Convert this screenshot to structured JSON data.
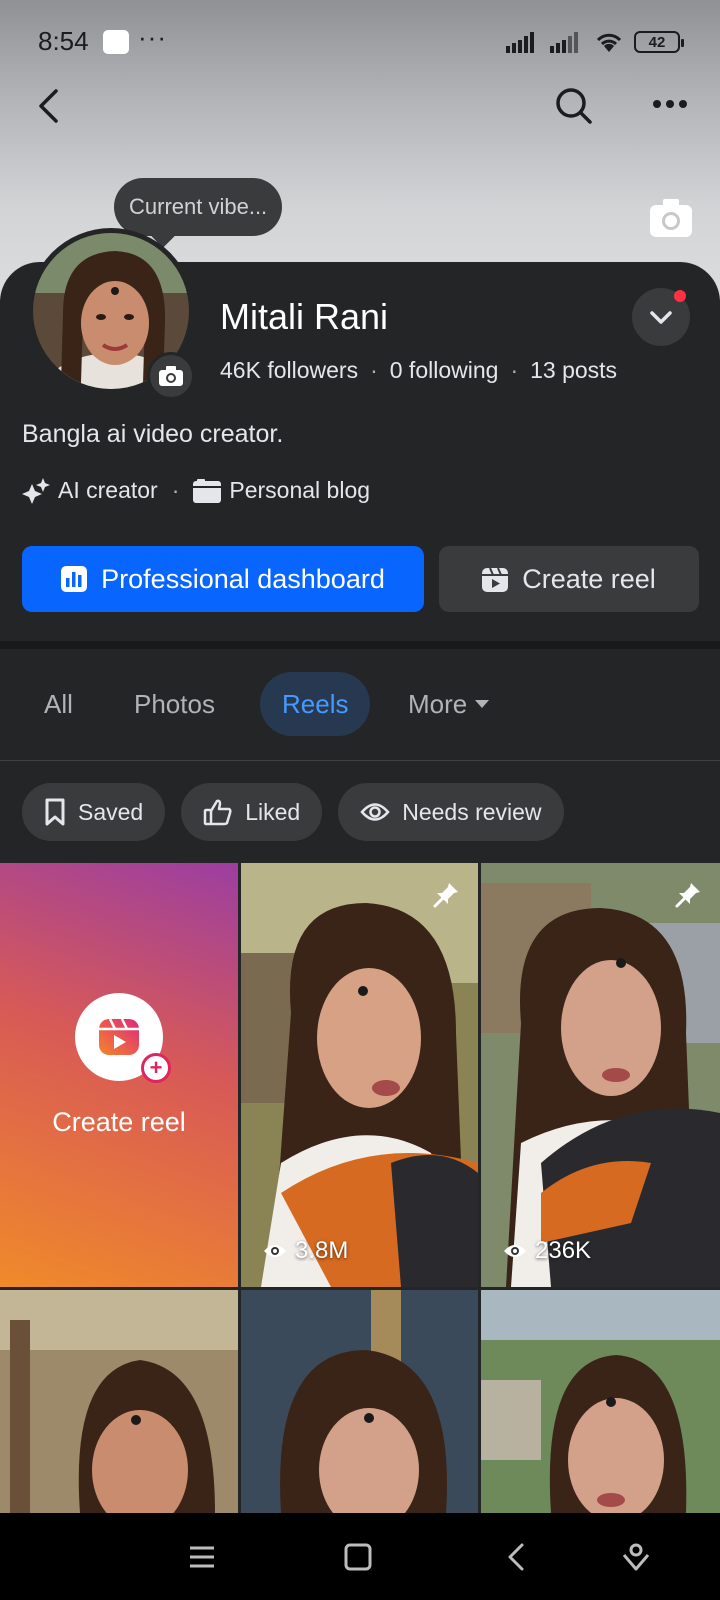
{
  "status_bar": {
    "time": "8:54",
    "more_dots": "···",
    "battery": "42"
  },
  "cover": {
    "vibe_prompt": "Current vibe..."
  },
  "profile": {
    "name": "Mitali Rani",
    "followers": "46K followers",
    "following": "0 following",
    "posts": "13 posts",
    "stats_separator": "·",
    "bio": "Bangla ai video creator.",
    "category_1": "AI creator",
    "category_2": "Personal blog"
  },
  "actions": {
    "dashboard_label": "Professional dashboard",
    "create_reel_label": "Create reel"
  },
  "tabs": {
    "all": "All",
    "photos": "Photos",
    "reels": "Reels",
    "more": "More",
    "active": "Reels"
  },
  "filters": {
    "saved": "Saved",
    "liked": "Liked",
    "needs_review": "Needs review"
  },
  "grid": {
    "create_label": "Create reel",
    "reel_1_views": "3.8M",
    "reel_2_views": "236K"
  },
  "colors": {
    "primary": "#0866ff",
    "active_tab_text": "#4599ff",
    "notification": "#ff3040",
    "card_bg": "#242526"
  },
  "icons": {
    "back": "back-arrow-icon",
    "search": "search-icon",
    "more": "more-icon",
    "camera": "camera-icon",
    "chevron": "chevron-down-icon",
    "ai": "sparkle-icon",
    "blog": "blog-icon",
    "dashboard": "bar-chart-icon",
    "reel": "reel-icon",
    "bookmark": "bookmark-icon",
    "like": "thumbs-up-icon",
    "eye": "eye-icon",
    "pin": "pin-icon"
  }
}
